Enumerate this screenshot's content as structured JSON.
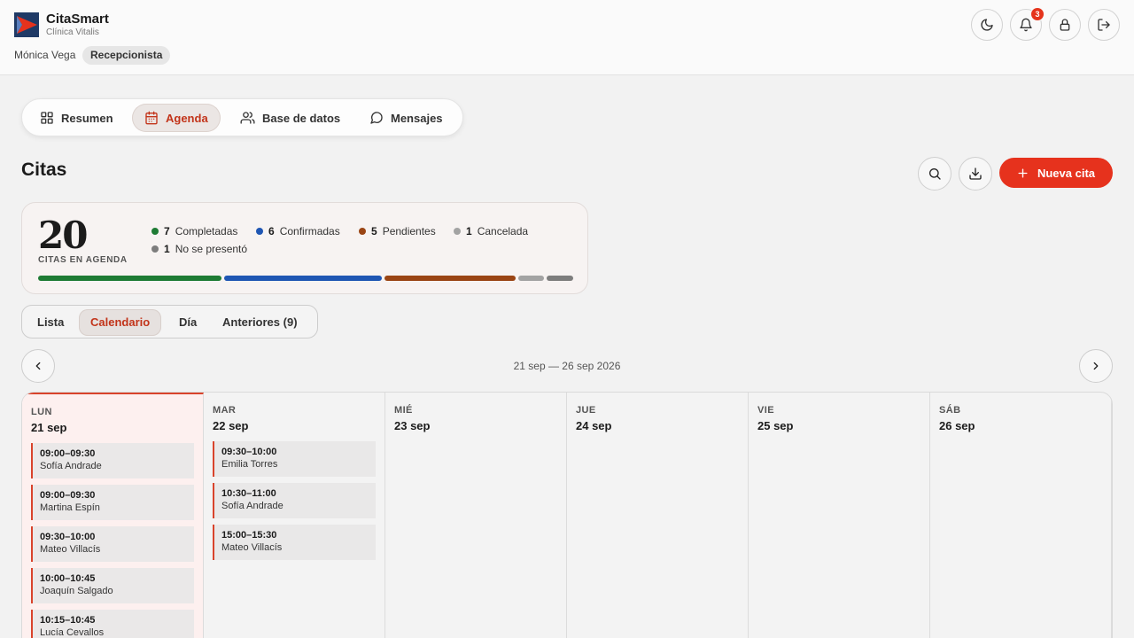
{
  "app": {
    "name": "CitaSmart",
    "clinic": "Clínica Vitalis"
  },
  "user": {
    "name": "Mónica Vega",
    "role": "Recepcionista"
  },
  "header_buttons": {
    "notifications_count": "3"
  },
  "nav": {
    "items": [
      {
        "label": "Resumen",
        "icon": "grid-icon"
      },
      {
        "label": "Agenda",
        "icon": "calendar-icon",
        "active": true
      },
      {
        "label": "Base de datos",
        "icon": "users-icon"
      },
      {
        "label": "Mensajes",
        "icon": "chat-icon"
      }
    ]
  },
  "page": {
    "title": "Citas",
    "new_button": "Nueva cita"
  },
  "summary": {
    "total": "20",
    "total_label": "CITAS EN AGENDA",
    "statuses": [
      {
        "count": "7",
        "label": "Completadas",
        "color": "#1e7b34",
        "value": 7
      },
      {
        "count": "6",
        "label": "Confirmadas",
        "color": "#1f56b3",
        "value": 6
      },
      {
        "count": "5",
        "label": "Pendientes",
        "color": "#9a4514",
        "value": 5
      },
      {
        "count": "1",
        "label": "Cancelada",
        "color": "#a3a3a3",
        "value": 1
      },
      {
        "count": "1",
        "label": "No se presentó",
        "color": "#7d7d7d",
        "value": 1
      }
    ]
  },
  "view_tabs": [
    {
      "label": "Lista"
    },
    {
      "label": "Calendario",
      "active": true
    },
    {
      "label": "Día"
    },
    {
      "label": "Anteriores (9)"
    }
  ],
  "week": {
    "range": "21 sep — 26 sep 2026"
  },
  "days": [
    {
      "abbr": "LUN",
      "date": "21 sep",
      "today": true,
      "appointments": [
        {
          "time": "09:00–09:30",
          "name": "Sofía Andrade"
        },
        {
          "time": "09:00–09:30",
          "name": "Martina Espín"
        },
        {
          "time": "09:30–10:00",
          "name": "Mateo Villacís"
        },
        {
          "time": "10:00–10:45",
          "name": "Joaquín Salgado"
        },
        {
          "time": "10:15–10:45",
          "name": "Lucía Cevallos"
        }
      ]
    },
    {
      "abbr": "MAR",
      "date": "22 sep",
      "appointments": [
        {
          "time": "09:30–10:00",
          "name": "Emilia Torres"
        },
        {
          "time": "10:30–11:00",
          "name": "Sofía Andrade"
        },
        {
          "time": "15:00–15:30",
          "name": "Mateo Villacís"
        }
      ]
    },
    {
      "abbr": "MIÉ",
      "date": "23 sep",
      "appointments": []
    },
    {
      "abbr": "JUE",
      "date": "24 sep",
      "appointments": []
    },
    {
      "abbr": "VIE",
      "date": "25 sep",
      "appointments": []
    },
    {
      "abbr": "SÁB",
      "date": "26 sep",
      "appointments": []
    }
  ],
  "colors": {
    "accent": "#e6321d",
    "active_text": "#c2341a"
  }
}
